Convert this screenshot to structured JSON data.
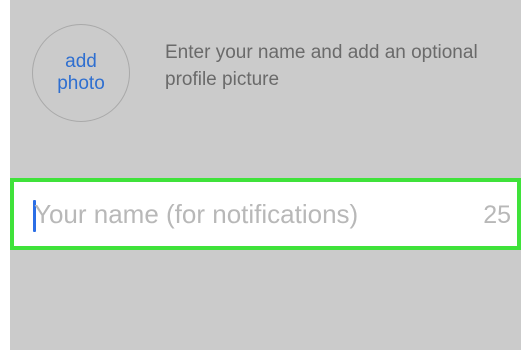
{
  "profile": {
    "photo_button_line1": "add",
    "photo_button_line2": "photo",
    "instructions": "Enter your name and add an optional profile picture"
  },
  "name_field": {
    "placeholder": "Your name (for notifications)",
    "value": "",
    "remaining_chars": "25"
  },
  "colors": {
    "background": "#cbcbcb",
    "accent": "#2f6fd0",
    "highlight": "#3fe23a",
    "caret": "#2b6ee6"
  }
}
